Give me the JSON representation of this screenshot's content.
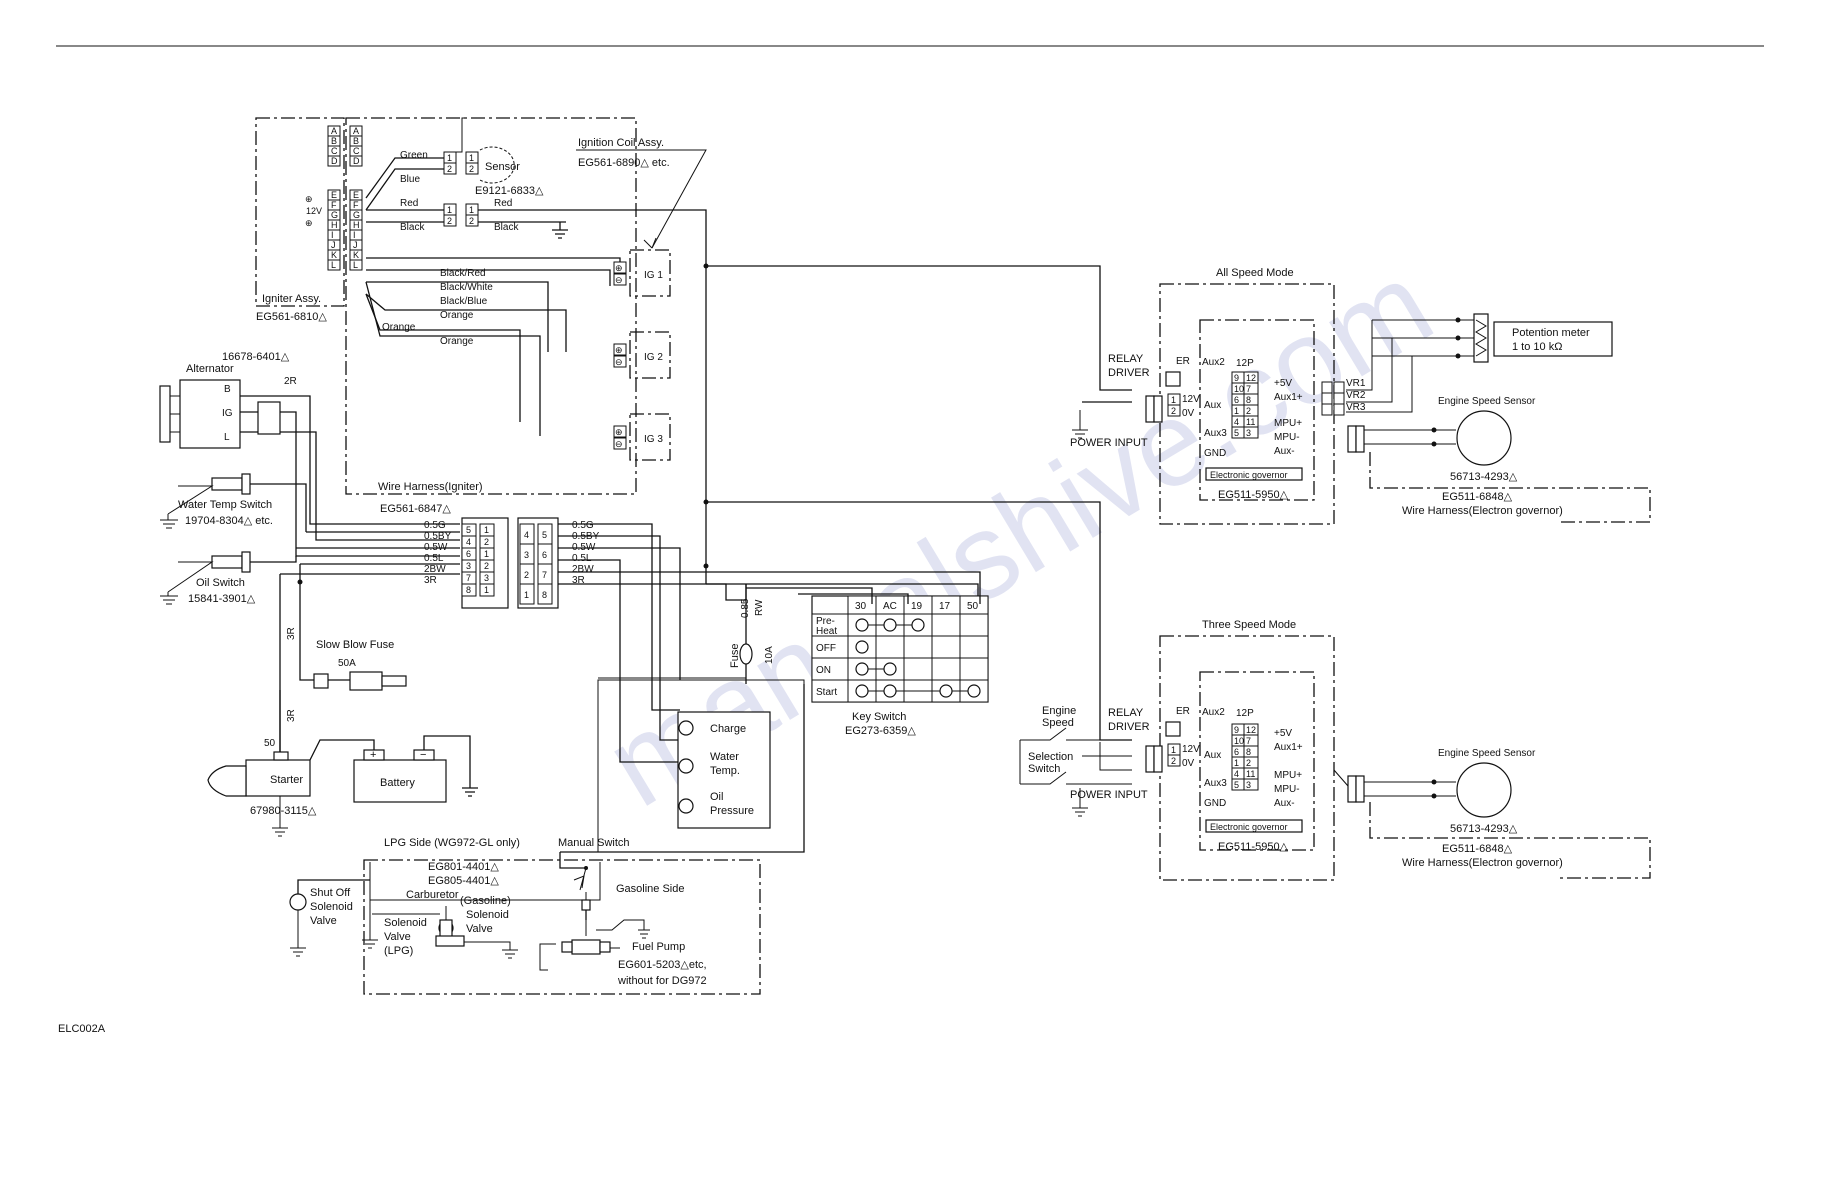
{
  "page_id": "ELC002A",
  "ignition_coil": {
    "title": "Ignition Coil Assy.",
    "part": "EG561-6890△  etc.",
    "coils": [
      "IG 1",
      "IG 2",
      "IG 3"
    ]
  },
  "sensor": {
    "label": "Sensor",
    "part": "E9121-6833△"
  },
  "igniter": {
    "label": "Igniter Assy.",
    "part": "EG561-6810△",
    "pins": [
      "A",
      "B",
      "C",
      "D",
      "E",
      "F",
      "G",
      "H",
      "I",
      "J",
      "K",
      "L"
    ],
    "plus": "⊕",
    "voltage": "12V"
  },
  "wire_colors": {
    "green": "Green",
    "blue": "Blue",
    "red": "Red",
    "black": "Black",
    "red2": "Red",
    "black2": "Black",
    "black_red": "Black/Red",
    "black_white": "Black/White",
    "black_blue": "Black/Blue",
    "orange1": "Orange",
    "orange2": "Orange",
    "orange3": "Orange"
  },
  "wire_harness_igniter": {
    "label": "Wire Harness(Igniter)",
    "part": "EG561-6847△"
  },
  "alternator": {
    "part": "16678-6401△",
    "label": "Alternator",
    "terminals": [
      "B",
      "IG",
      "L"
    ],
    "wire": "2R"
  },
  "water_temp_switch": {
    "label": "Water Temp Switch",
    "part": "19704-8304△  etc."
  },
  "oil_switch": {
    "label": "Oil Switch",
    "part": "15841-3901△"
  },
  "connector_left": {
    "wires": [
      "0.5G",
      "0.5BY",
      "0.5W",
      "0.5L",
      "2BW",
      "3R"
    ],
    "pins_a": [
      "5",
      "4",
      "6",
      "3",
      "7",
      "8"
    ],
    "pins_b": [
      "1",
      "2",
      "1",
      "2",
      "3",
      "1"
    ]
  },
  "connector_right": {
    "wires": [
      "0.5G",
      "0.5BY",
      "0.5W",
      "0.5L",
      "2BW",
      "3R"
    ],
    "pins_a": [
      "4",
      "3",
      "2",
      "1"
    ],
    "pins_b": [
      "5",
      "6",
      "7",
      "8"
    ]
  },
  "slow_blow_fuse": {
    "label": "Slow Blow Fuse",
    "rating": "50A",
    "wire": "3R"
  },
  "starter": {
    "label": "Starter",
    "part": "67980-3115△",
    "terminal": "50",
    "wire": "3R"
  },
  "battery": {
    "label": "Battery",
    "plus": "+",
    "minus": "−"
  },
  "fuse": {
    "label": "Fuse",
    "wire1": "0.85",
    "wire2": "RW",
    "rating": "10A"
  },
  "key_switch": {
    "label": "Key Switch",
    "part": "EG273-6359△",
    "columns": [
      "30",
      "AC",
      "19",
      "17",
      "50"
    ],
    "rows": [
      "Pre-\nHeat",
      "OFF",
      "ON",
      "Start"
    ]
  },
  "lamps": {
    "charge": "Charge",
    "water": "Water\nTemp.",
    "oil": "Oil\nPressure"
  },
  "lpg": {
    "side": "LPG Side (WG972-GL only)",
    "manual_switch": "Manual Switch",
    "part1": "EG801-4401△",
    "part2": "EG805-4401△",
    "carburetor": "Carburetor",
    "gasoline_side": "Gasoline Side",
    "shut_off": "Shut Off\nSolenoid\nValve",
    "solenoid_lpg": "Solenoid\nValve\n(LPG)",
    "solenoid_gas": "(Gasoline)\nSolenoid\nValve",
    "fuel_pump": "Fuel Pump",
    "fuel_pump_part": "EG601-5203△etc,",
    "fuel_pump_note": "without for DG972"
  },
  "all_speed": {
    "title": "All Speed Mode",
    "relay": "RELAY\nDRIVER",
    "power": "POWER INPUT",
    "er": "ER",
    "aux2": "Aux2",
    "p12": "12P",
    "v12": "12V",
    "v0": "0V",
    "aux": "Aux",
    "aux3": "Aux3",
    "gnd": "GND",
    "plus5": "+5V",
    "auxp": "Aux1+",
    "mpup": "MPU+",
    "mpum": "MPU-",
    "auxm": "Aux-",
    "pins_l": [
      "9",
      "10",
      "6",
      "1",
      "4",
      "5"
    ],
    "pins_r": [
      "12",
      "7",
      "8",
      "2",
      "11",
      "3"
    ],
    "vr": [
      "VR1",
      "VR2",
      "VR3"
    ],
    "egov": "Electronic governor",
    "egov_part": "EG511-5950△",
    "pot": "Potention meter\n1 to 10 kΩ",
    "ess": "Engine Speed Sensor",
    "ess_part": "56713-4293△",
    "harness_part": "EG511-6848△",
    "harness": "Wire Harness(Electron governor)"
  },
  "three_speed": {
    "title": "Three Speed Mode",
    "relay": "RELAY\nDRIVER",
    "power": "POWER INPUT",
    "selection": "Engine\nSpeed\nSelection\nSwitch",
    "er": "ER",
    "aux2": "Aux2",
    "p12": "12P",
    "v12": "12V",
    "v0": "0V",
    "aux": "Aux",
    "aux3": "Aux3",
    "gnd": "GND",
    "plus5": "+5V",
    "auxp": "Aux1+",
    "mpup": "MPU+",
    "mpum": "MPU-",
    "auxm": "Aux-",
    "pins_l": [
      "9",
      "10",
      "6",
      "1",
      "4",
      "5"
    ],
    "pins_r": [
      "12",
      "7",
      "8",
      "2",
      "11",
      "3"
    ],
    "egov": "Electronic governor",
    "egov_part": "EG511-5950△",
    "ess": "Engine Speed Sensor",
    "ess_part": "56713-4293△",
    "harness_part": "EG511-6848△",
    "harness": "Wire Harness(Electron governor)"
  },
  "watermark": "manualshive.com"
}
